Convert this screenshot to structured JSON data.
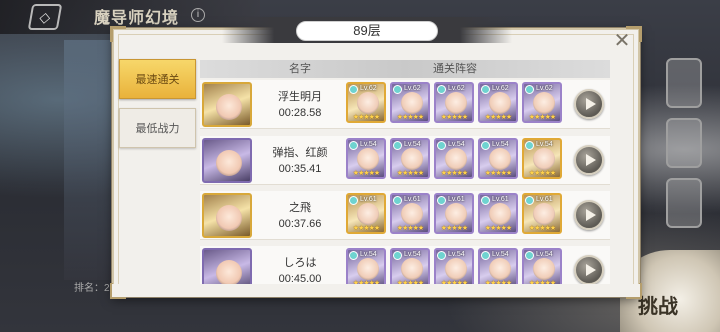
{
  "background": {
    "title": "魔导师幻境",
    "info_icon": "i",
    "back_icon": "back-diamond-icon",
    "rank_prefix": "排名：2",
    "challenge_label": "挑战"
  },
  "panel": {
    "floor": "89层",
    "close_icon": "✕",
    "tabs": [
      {
        "label": "最速通关",
        "active": true
      },
      {
        "label": "最低战力",
        "active": false
      }
    ],
    "headers": {
      "name": "名字",
      "team": "通关阵容"
    },
    "rows": [
      {
        "name": "浮生明月",
        "time": "00:28.58",
        "team": [
          {
            "lv": "Lv.62",
            "rarity": "gold",
            "stars": "★★★★★"
          },
          {
            "lv": "Lv.62",
            "rarity": "purple",
            "stars": "★★★★★"
          },
          {
            "lv": "Lv.62",
            "rarity": "purple",
            "stars": "★★★★★"
          },
          {
            "lv": "Lv.62",
            "rarity": "purple",
            "stars": "★★★★★"
          },
          {
            "lv": "Lv.62",
            "rarity": "purple",
            "stars": "★★★★★"
          }
        ]
      },
      {
        "name": "弹指、红颜",
        "time": "00:35.41",
        "team": [
          {
            "lv": "Lv.54",
            "rarity": "purple",
            "stars": "★★★★★"
          },
          {
            "lv": "Lv.54",
            "rarity": "purple",
            "stars": "★★★★★"
          },
          {
            "lv": "Lv.54",
            "rarity": "purple",
            "stars": "★★★★★"
          },
          {
            "lv": "Lv.54",
            "rarity": "purple",
            "stars": "★★★★★"
          },
          {
            "lv": "Lv.54",
            "rarity": "gold",
            "stars": "★★★★★"
          }
        ]
      },
      {
        "name": "之飛",
        "time": "00:37.66",
        "team": [
          {
            "lv": "Lv.61",
            "rarity": "gold",
            "stars": "★★★★★"
          },
          {
            "lv": "Lv.61",
            "rarity": "purple",
            "stars": "★★★★★"
          },
          {
            "lv": "Lv.61",
            "rarity": "purple",
            "stars": "★★★★★"
          },
          {
            "lv": "Lv.61",
            "rarity": "purple",
            "stars": "★★★★★"
          },
          {
            "lv": "Lv.61",
            "rarity": "gold",
            "stars": "★★★★★"
          }
        ]
      },
      {
        "name": "しろは",
        "time": "00:45.00",
        "team": [
          {
            "lv": "Lv.54",
            "rarity": "purple",
            "stars": "★★★★★"
          },
          {
            "lv": "Lv.54",
            "rarity": "purple",
            "stars": "★★★★★"
          },
          {
            "lv": "Lv.54",
            "rarity": "purple",
            "stars": "★★★★★"
          },
          {
            "lv": "Lv.54",
            "rarity": "purple",
            "stars": "★★★★★"
          },
          {
            "lv": "Lv.54",
            "rarity": "purple",
            "stars": "★★★★★"
          }
        ]
      }
    ]
  },
  "colors": {
    "tab_active": "#e9b23b",
    "panel_bg": "#f2f0ec",
    "gold_frame": "#e0a936",
    "purple_frame": "#9b82c9"
  }
}
